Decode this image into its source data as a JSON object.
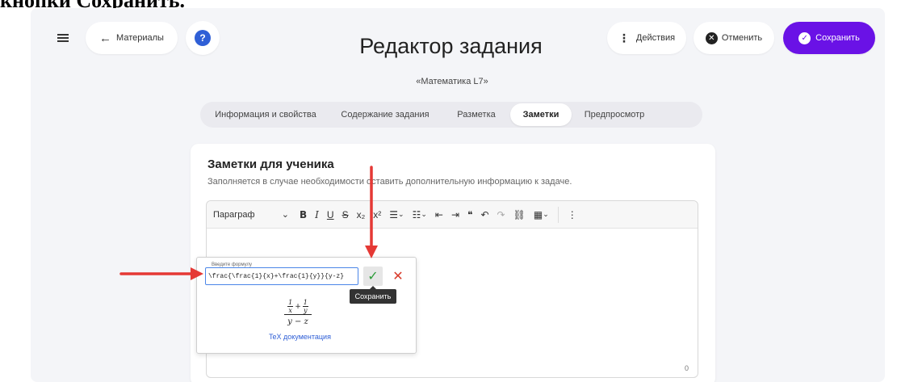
{
  "cut_heading": "кнопки Сохранить.",
  "header": {
    "back_label": "Материалы",
    "help_label": "?",
    "title": "Редактор задания",
    "subtitle": "«Математика L7»",
    "actions_label": "Действия",
    "cancel_label": "Отменить",
    "save_label": "Сохранить"
  },
  "tabs": [
    {
      "label": "Информация и свойства",
      "active": false
    },
    {
      "label": "Содержание задания",
      "active": false
    },
    {
      "label": "Разметка",
      "active": false
    },
    {
      "label": "Заметки",
      "active": true
    },
    {
      "label": "Предпросмотр",
      "active": false
    }
  ],
  "notes": {
    "title": "Заметки для ученика",
    "description": "Заполняется в случае необходимости оставить дополнительную информацию к задаче."
  },
  "toolbar": {
    "paragraph_label": "Параграф",
    "bold": "B",
    "italic": "I",
    "underline": "U",
    "strike": "S",
    "subscript": "x₂",
    "superscript": "x²",
    "quote": "❝",
    "undo": "↶",
    "redo": "↷",
    "link": "🔗",
    "table": "▦",
    "more": "⋮"
  },
  "formula_popup": {
    "legend": "Введите формулу",
    "value": "\\frac{\\frac{1}{x}+\\frac{1}{y}}{y-z}",
    "confirm_tooltip": "Сохранить",
    "preview": {
      "num1": "1",
      "den1": "x",
      "num2": "1",
      "den2": "y",
      "plus": "+",
      "denominator": "y − z"
    },
    "docs_link": "TeX документация"
  },
  "editor": {
    "char_count": "0"
  },
  "colors": {
    "accent": "#6a12e6",
    "link": "#2f5fd6",
    "annotation_arrow": "#e53935"
  }
}
